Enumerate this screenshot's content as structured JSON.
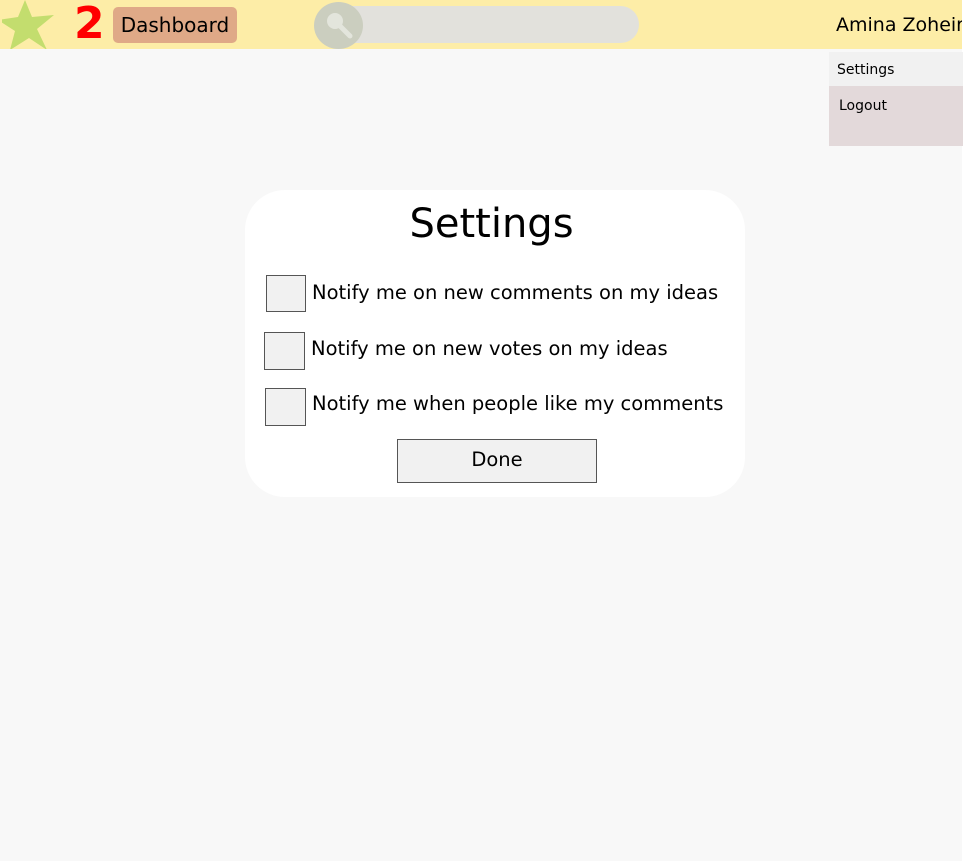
{
  "header": {
    "notification_count": "2",
    "dashboard_label": "Dashboard",
    "user_name": "Amina Zoheir",
    "logo_icon": "star-icon",
    "search_icon": "search-icon"
  },
  "user_menu": {
    "items": [
      {
        "label": "Settings"
      },
      {
        "label": "Logout"
      }
    ]
  },
  "settings_dialog": {
    "title": "Settings",
    "options": [
      {
        "label": "Notify me on new comments on my ideas",
        "checked": false
      },
      {
        "label": "Notify me on new votes on my ideas",
        "checked": false
      },
      {
        "label": "Notify me when people like my comments",
        "checked": false
      }
    ],
    "done_label": "Done"
  },
  "colors": {
    "header_bg": "#fdeda7",
    "badge_red": "#ff0000",
    "dashboard_button": "#dfa987",
    "star_green": "#c3dd6e",
    "search_bar": "#e2e1dc",
    "menu_bg": "#e3d9da"
  }
}
